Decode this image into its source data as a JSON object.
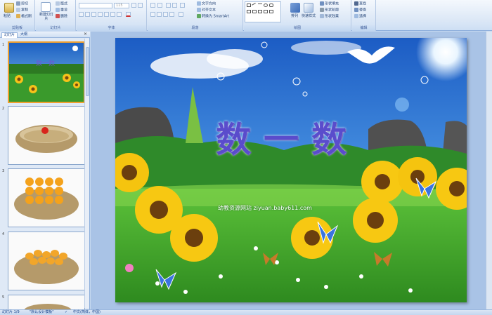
{
  "ribbon": {
    "clipboard": {
      "label": "剪贴板",
      "paste": "粘贴",
      "cut": "剪切",
      "copy": "复制",
      "format_painter": "格式刷"
    },
    "slides": {
      "label": "幻灯片",
      "new_slide": "新建幻灯片",
      "layout": "版式",
      "reset": "重设",
      "delete": "删除"
    },
    "font": {
      "label": "字体",
      "font_size": "115"
    },
    "paragraph": {
      "label": "段落",
      "text_direction": "文字方向",
      "align_text": "对齐文本",
      "smartart": "转换为 SmartArt"
    },
    "drawing": {
      "label": "绘图",
      "arrange": "排列",
      "quick_styles": "快速样式",
      "shape_fill": "形状填充",
      "shape_outline": "形状轮廓",
      "shape_effects": "形状效果"
    },
    "editing": {
      "label": "编辑",
      "find": "查找",
      "replace": "替换",
      "select": "选择"
    }
  },
  "panel": {
    "tab_slides": "幻灯片",
    "tab_outline": "大纲",
    "slide_numbers": [
      "1",
      "2",
      "3",
      "4",
      "5"
    ]
  },
  "slide": {
    "title": "数一数",
    "watermark": "幼教资源网站 ziyuan.baby611.com"
  },
  "status": {
    "slide_count": "幻灯片 1/9",
    "theme": "\"默认设计模板\"",
    "language": "中文(简体，中国)"
  },
  "colors": {
    "title_purple": "#6a5bd0",
    "sky_blue": "#2f7fd8",
    "grass_green": "#3fa032",
    "selected_border": "#f0a030"
  }
}
